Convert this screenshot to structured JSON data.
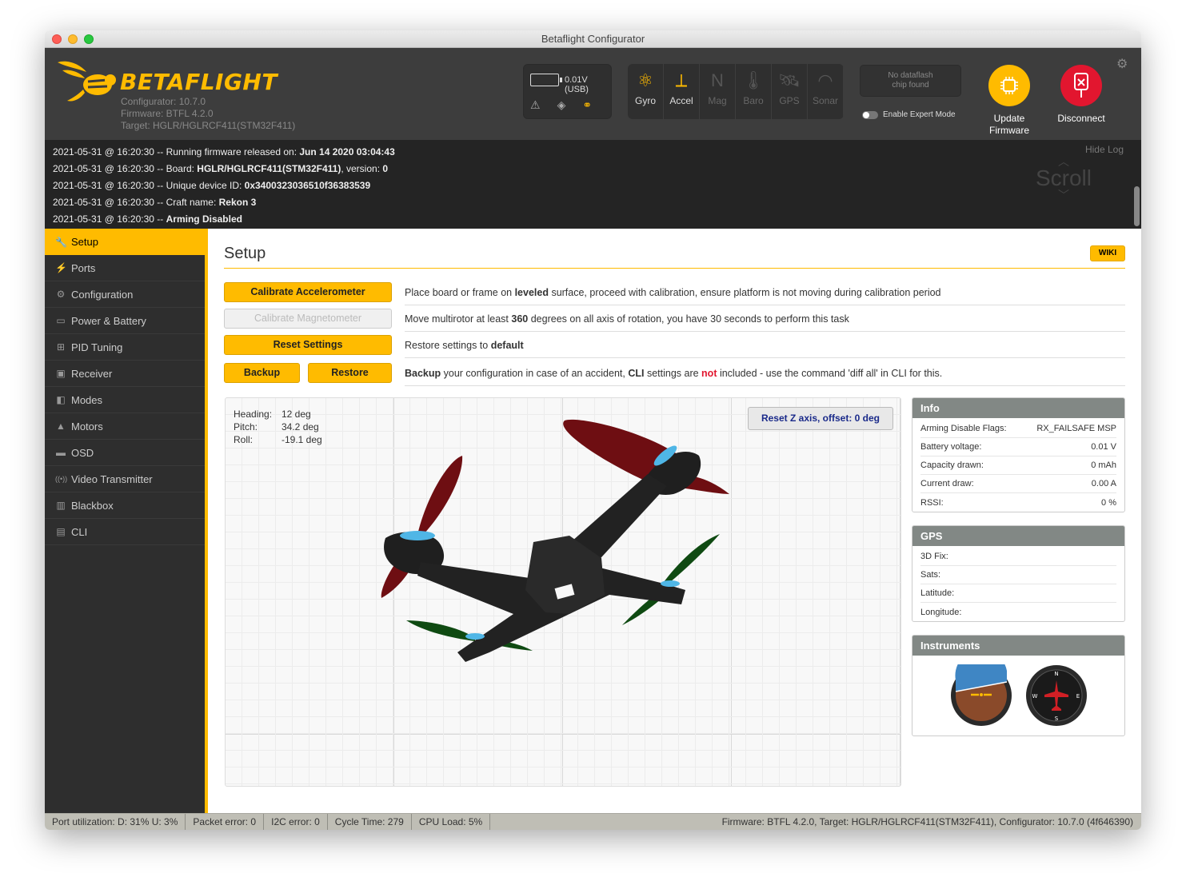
{
  "window": {
    "title": "Betaflight Configurator"
  },
  "header": {
    "logo": "BETAFLIGHT",
    "configurator": "Configurator: 10.7.0",
    "firmware": "Firmware: BTFL 4.2.0",
    "target": "Target: HGLR/HGLRCF411(STM32F411)",
    "battery": "0.01V (USB)",
    "sensors": [
      {
        "label": "Gyro",
        "icon": "gyro-icon",
        "active": true
      },
      {
        "label": "Accel",
        "icon": "accel-icon",
        "active": true
      },
      {
        "label": "Mag",
        "icon": "mag-icon",
        "active": false
      },
      {
        "label": "Baro",
        "icon": "baro-icon",
        "active": false
      },
      {
        "label": "GPS",
        "icon": "gps-icon",
        "active": false
      },
      {
        "label": "Sonar",
        "icon": "sonar-icon",
        "active": false
      }
    ],
    "dataflash_line1": "No dataflash",
    "dataflash_line2": "chip found",
    "expert_mode": "Enable Expert Mode",
    "update_line1": "Update",
    "update_line2": "Firmware",
    "disconnect": "Disconnect"
  },
  "log": {
    "lines": [
      {
        "prefix": "2021-05-31 @ 16:20:30 -- Running firmware released on: ",
        "bold": "Jun 14 2020 03:04:43",
        "suffix": ""
      },
      {
        "prefix": "2021-05-31 @ 16:20:30 -- Board: ",
        "bold": "HGLR/HGLRCF411(STM32F411)",
        "suffix": ", version: ",
        "bold2": "0"
      },
      {
        "prefix": "2021-05-31 @ 16:20:30 -- Unique device ID: ",
        "bold": "0x3400323036510f36383539",
        "suffix": ""
      },
      {
        "prefix": "2021-05-31 @ 16:20:30 -- Craft name: ",
        "bold": "Rekon 3",
        "suffix": ""
      },
      {
        "prefix": "2021-05-31 @ 16:20:30 -- ",
        "bold": "Arming Disabled",
        "suffix": ""
      }
    ],
    "hide": "Hide Log",
    "scroll": "Scroll"
  },
  "sidebar": {
    "items": [
      {
        "label": "Setup",
        "icon": "wrench-icon",
        "glyph": "🔧"
      },
      {
        "label": "Ports",
        "icon": "plug-icon",
        "glyph": "⚡"
      },
      {
        "label": "Configuration",
        "icon": "gear-icon",
        "glyph": "⚙"
      },
      {
        "label": "Power & Battery",
        "icon": "battery-icon",
        "glyph": "▭"
      },
      {
        "label": "PID Tuning",
        "icon": "sitemap-icon",
        "glyph": "⊞"
      },
      {
        "label": "Receiver",
        "icon": "receiver-icon",
        "glyph": "▣"
      },
      {
        "label": "Modes",
        "icon": "toggle-icon",
        "glyph": "◧"
      },
      {
        "label": "Motors",
        "icon": "motor-icon",
        "glyph": "▲"
      },
      {
        "label": "OSD",
        "icon": "osd-icon",
        "glyph": "▬"
      },
      {
        "label": "Video Transmitter",
        "icon": "antenna-icon",
        "glyph": "((•))"
      },
      {
        "label": "Blackbox",
        "icon": "blackbox-icon",
        "glyph": "▥"
      },
      {
        "label": "CLI",
        "icon": "terminal-icon",
        "glyph": "▤"
      }
    ]
  },
  "setup": {
    "title": "Setup",
    "wiki": "WIKI",
    "calibrate_acc": "Calibrate Accelerometer",
    "calibrate_acc_text": {
      "a": "Place board or frame on ",
      "b": "leveled",
      "c": " surface, proceed with calibration, ensure platform is not moving during calibration period"
    },
    "calibrate_mag": "Calibrate Magnetometer",
    "calibrate_mag_text": {
      "a": "Move multirotor at least ",
      "b": "360",
      "c": " degrees on all axis of rotation, you have 30 seconds to perform this task"
    },
    "reset": "Reset Settings",
    "reset_text": {
      "a": "Restore settings to ",
      "b": "default"
    },
    "backup": "Backup",
    "restore": "Restore",
    "backup_text": {
      "a": "Backup",
      "b": " your configuration in case of an accident, ",
      "c": "CLI",
      "d": " settings are ",
      "e": "not",
      "f": " included - use the command 'diff all' in CLI for this."
    },
    "heading_label": "Heading:",
    "heading": "12 deg",
    "pitch_label": "Pitch:",
    "pitch": "34.2 deg",
    "roll_label": "Roll:",
    "roll": "-19.1 deg",
    "reset_z": "Reset Z axis, offset: 0 deg"
  },
  "info": {
    "title": "Info",
    "rows": [
      {
        "k": "Arming Disable Flags:",
        "v": "RX_FAILSAFE  MSP"
      },
      {
        "k": "Battery voltage:",
        "v": "0.01 V"
      },
      {
        "k": "Capacity drawn:",
        "v": "0 mAh"
      },
      {
        "k": "Current draw:",
        "v": "0.00 A"
      },
      {
        "k": "RSSI:",
        "v": "0 %"
      }
    ]
  },
  "gps": {
    "title": "GPS",
    "rows": [
      {
        "k": "3D Fix:",
        "v": ""
      },
      {
        "k": "Sats:",
        "v": ""
      },
      {
        "k": "Latitude:",
        "v": ""
      },
      {
        "k": "Longitude:",
        "v": ""
      }
    ]
  },
  "instruments": {
    "title": "Instruments"
  },
  "statusbar": {
    "port": "Port utilization: D: 31% U: 3%",
    "packet": "Packet error: 0",
    "i2c": "I2C error: 0",
    "cycle": "Cycle Time: 279",
    "cpu": "CPU Load: 5%",
    "firmware": "Firmware: BTFL 4.2.0, Target: HGLR/HGLRCF411(STM32F411), Configurator: 10.7.0 (4f646390)"
  },
  "colors": {
    "accent": "#ffbb00",
    "disconnect": "#e2162f",
    "header": "#3d3d3d"
  }
}
